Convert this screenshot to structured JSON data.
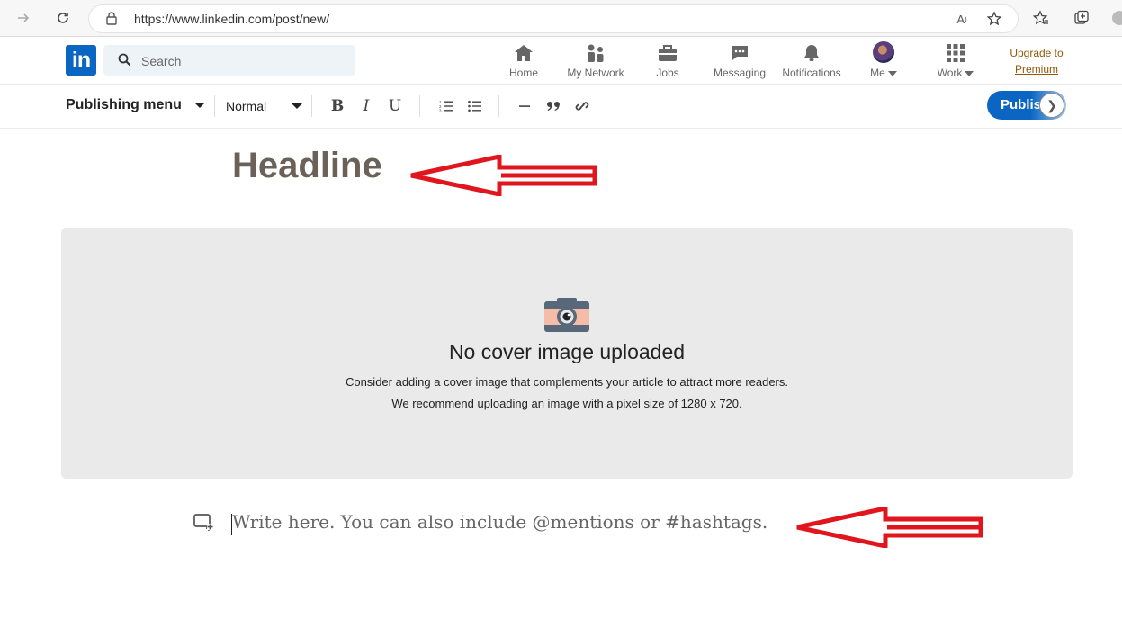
{
  "browser": {
    "url": "https://www.linkedin.com/post/new/"
  },
  "header": {
    "logo_text": "in",
    "search_placeholder": "Search",
    "nav": [
      {
        "label": "Home",
        "icon": "home-icon"
      },
      {
        "label": "My Network",
        "icon": "network-icon"
      },
      {
        "label": "Jobs",
        "icon": "briefcase-icon"
      },
      {
        "label": "Messaging",
        "icon": "message-icon"
      },
      {
        "label": "Notifications",
        "icon": "bell-icon"
      },
      {
        "label": "Me",
        "icon": "avatar"
      },
      {
        "label": "Work",
        "icon": "grid-icon"
      }
    ],
    "premium_line1": "Upgrade to",
    "premium_line2": "Premium"
  },
  "toolbar": {
    "publishing_menu": "Publishing menu",
    "text_style": "Normal",
    "bold": "B",
    "italic": "I",
    "underline": "U",
    "publish_label": "Publish",
    "publish_chevron": "❯"
  },
  "editor": {
    "headline_placeholder": "Headline",
    "cover_title": "No cover image uploaded",
    "cover_line1": "Consider adding a cover image that complements your article to attract more readers.",
    "cover_line2": "We recommend uploading an image with a pixel size of 1280 x 720.",
    "body_placeholder": "Write here. You can also include @mentions or #hashtags."
  },
  "colors": {
    "brand": "#0a66c2",
    "annotation_arrow": "#e0161e",
    "premium_link": "#915907"
  }
}
